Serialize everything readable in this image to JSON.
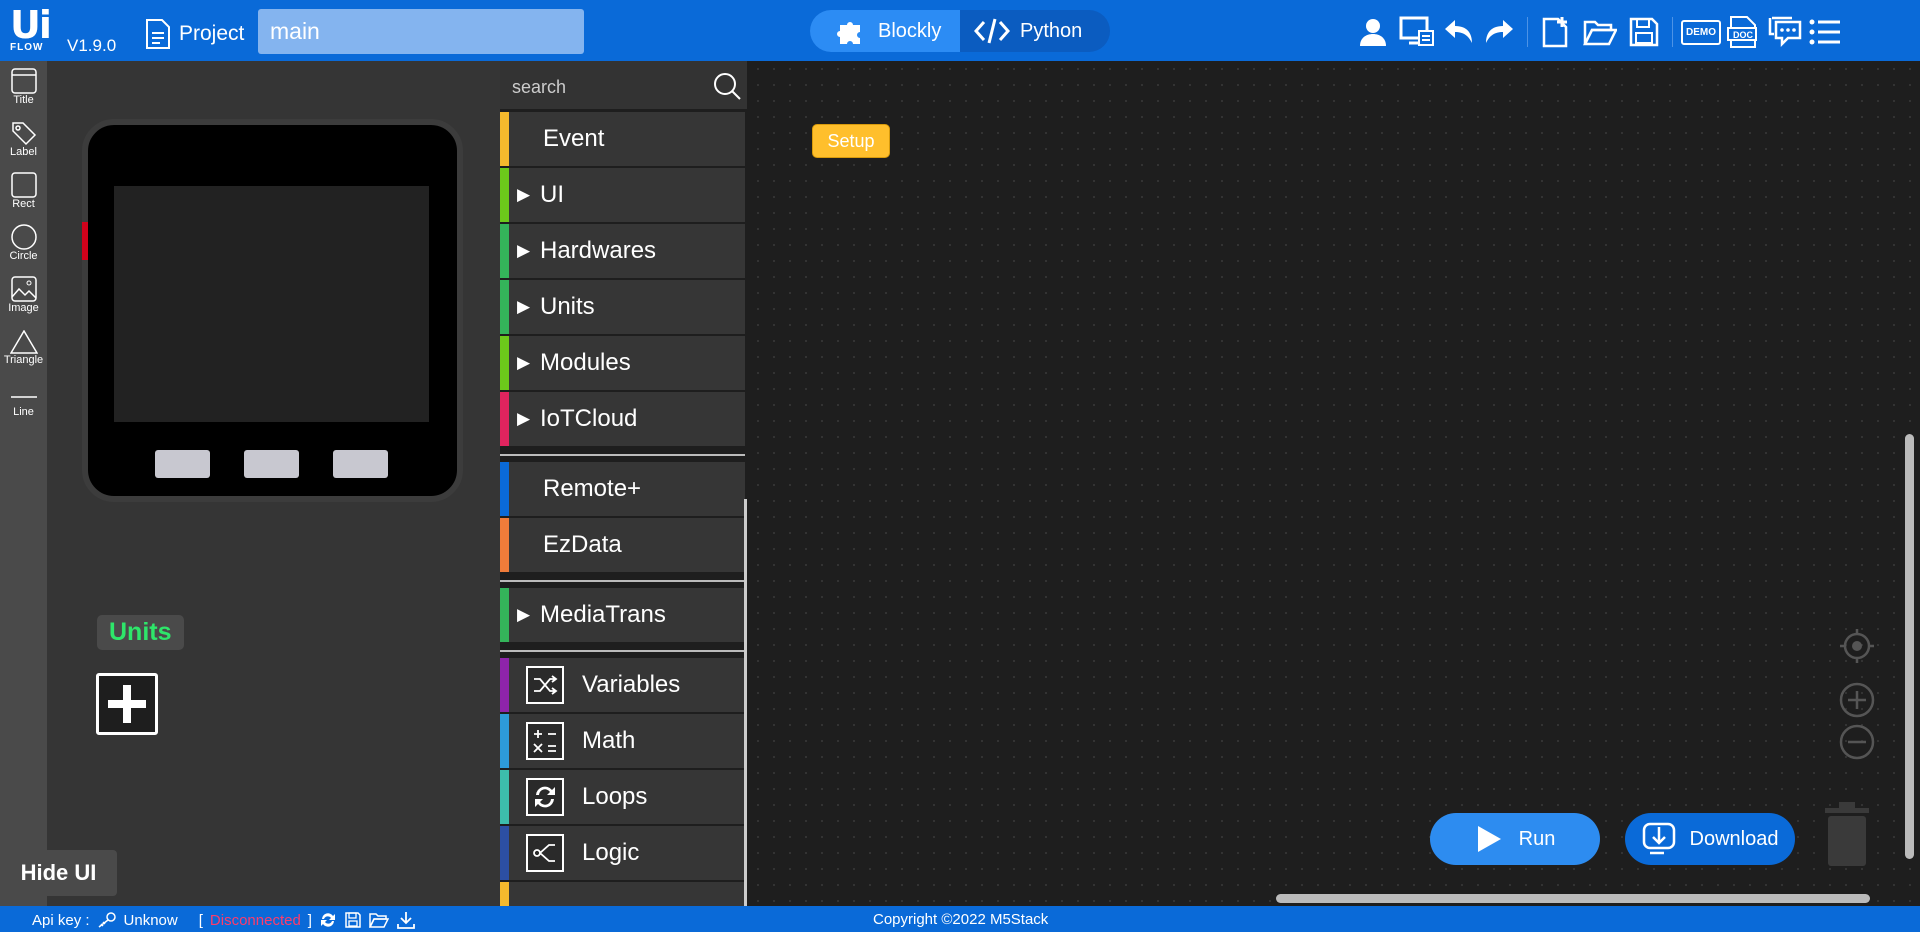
{
  "header": {
    "logo_ui": "Ui",
    "logo_flow": "FLOW",
    "version": "V1.9.0",
    "project_label": "Project",
    "project_name": "main",
    "modes": [
      {
        "label": "Blockly",
        "icon": "puzzle-icon",
        "active": true
      },
      {
        "label": "Python",
        "icon": "code-icon",
        "active": false
      }
    ],
    "demo_badge": "DEMO",
    "doc_badge": "DOC"
  },
  "shape_tools": [
    {
      "label": "Title",
      "icon": "title-shape-icon"
    },
    {
      "label": "Label",
      "icon": "label-tag-icon"
    },
    {
      "label": "Rect",
      "icon": "rect-shape-icon"
    },
    {
      "label": "Circle",
      "icon": "circle-shape-icon"
    },
    {
      "label": "Image",
      "icon": "image-shape-icon"
    },
    {
      "label": "Triangle",
      "icon": "triangle-shape-icon"
    },
    {
      "label": "Line",
      "icon": "line-shape-icon"
    }
  ],
  "ui_panel": {
    "units_label": "Units",
    "hide_ui": "Hide UI"
  },
  "palette": {
    "search_placeholder": "search",
    "categories": [
      {
        "label": "Event",
        "color": "#f5b92d",
        "expandable": false
      },
      {
        "label": "UI",
        "color": "#6cc91b",
        "expandable": true
      },
      {
        "label": "Hardwares",
        "color": "#34b45a",
        "expandable": true
      },
      {
        "label": "Units",
        "color": "#34b45a",
        "expandable": true
      },
      {
        "label": "Modules",
        "color": "#6cc91b",
        "expandable": true
      },
      {
        "label": "IoTCloud",
        "color": "#e0245e",
        "expandable": true
      },
      {
        "label": "Remote+",
        "color": "#0a6ad8",
        "expandable": false
      },
      {
        "label": "EzData",
        "color": "#f07c3a",
        "expandable": false
      },
      {
        "label": "MediaTrans",
        "color": "#34b45a",
        "expandable": true
      },
      {
        "label": "Variables",
        "color": "#8e24aa",
        "icon": "shuffle-icon"
      },
      {
        "label": "Math",
        "color": "#2d9ad9",
        "icon": "math-icon"
      },
      {
        "label": "Loops",
        "color": "#3dbdac",
        "icon": "loop-icon"
      },
      {
        "label": "Logic",
        "color": "#2c4fa3",
        "icon": "logic-icon"
      }
    ]
  },
  "workspace": {
    "setup_block": "Setup",
    "run_label": "Run",
    "download_label": "Download"
  },
  "statusbar": {
    "api_key_label": "Api key :",
    "api_key_value": "Unknow",
    "bracket_open": "[",
    "connection_status": "Disconnected",
    "bracket_close": "]",
    "copyright": "Copyright ©2022 M5Stack"
  }
}
